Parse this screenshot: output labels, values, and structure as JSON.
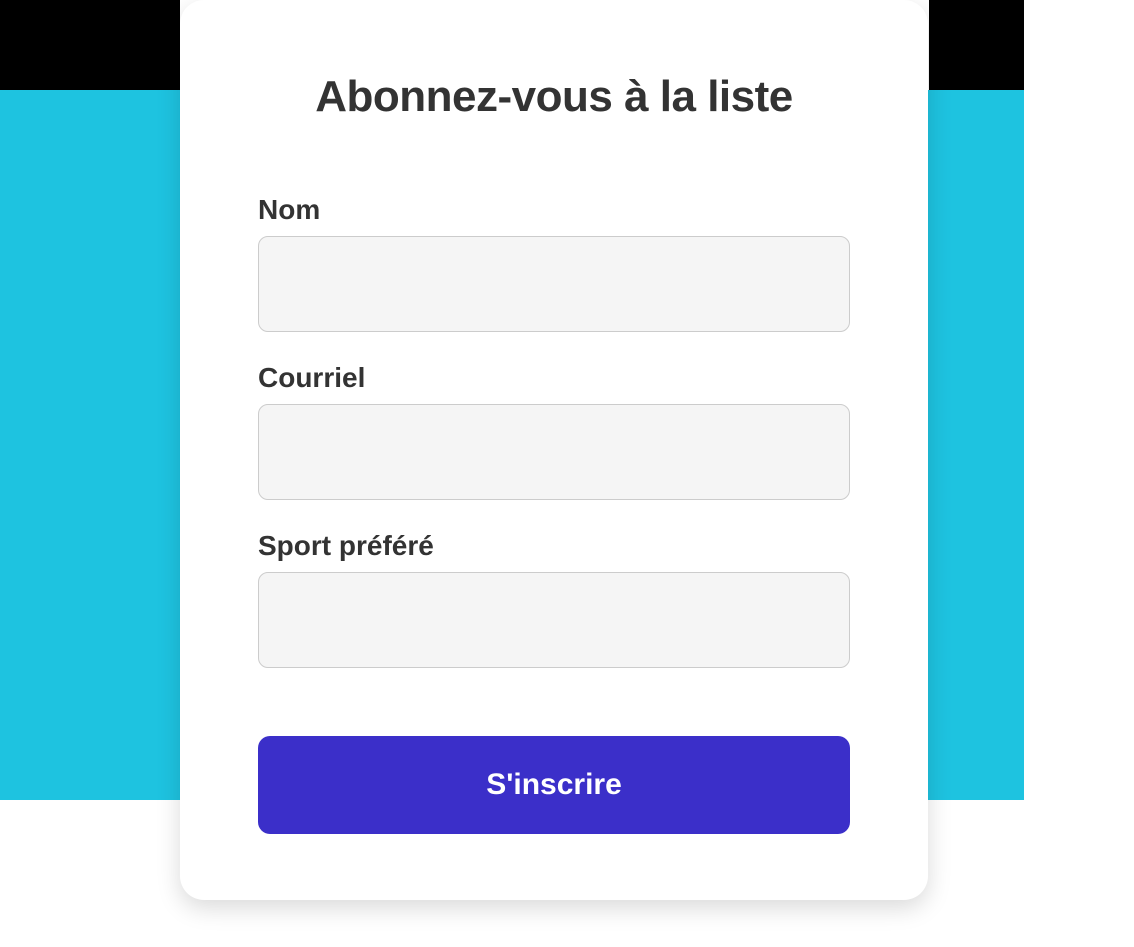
{
  "form": {
    "title": "Abonnez-vous à la liste",
    "fields": {
      "name": {
        "label": "Nom",
        "value": ""
      },
      "email": {
        "label": "Courriel",
        "value": ""
      },
      "sport": {
        "label": "Sport préféré",
        "value": ""
      }
    },
    "submit_label": "S'inscrire"
  },
  "colors": {
    "accent": "#1ec3e0",
    "primary_button": "#3b2fc9",
    "card_bg": "#ffffff",
    "input_bg": "#f5f5f5"
  }
}
